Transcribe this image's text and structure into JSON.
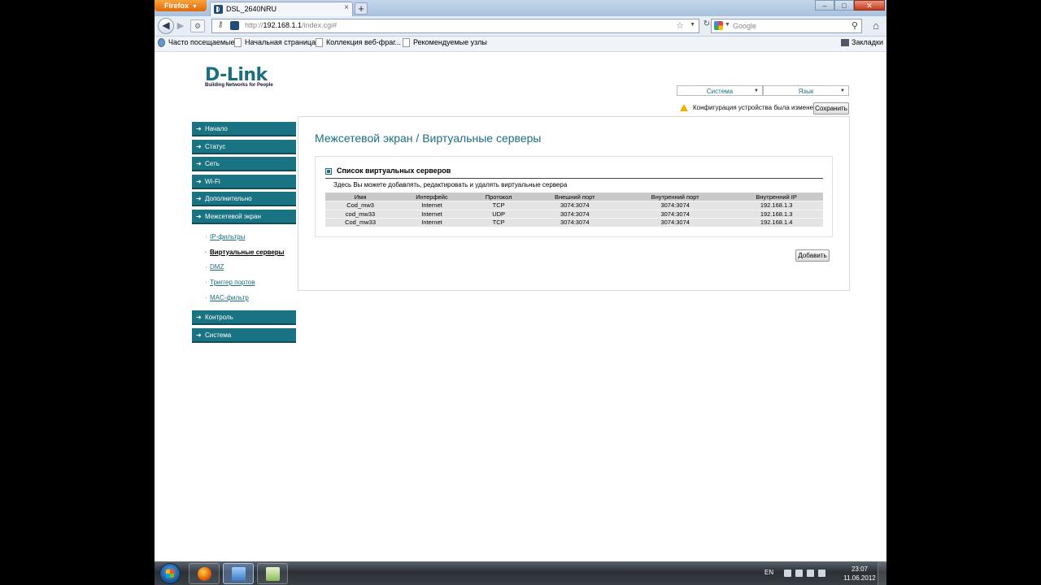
{
  "browser": {
    "app_button": "Firefox",
    "tab_title": "DSL_2640NRU",
    "new_tab_symbol": "+",
    "url_prefix": "http://",
    "url_host": "192.168.1.1",
    "url_path": "/index.cgi#",
    "search_placeholder": "Google",
    "bookmarks": [
      "Часто посещаемые",
      "Начальная страница",
      "Коллекция веб-фраг...",
      "Рекомендуемые узлы"
    ],
    "bookmarks_menu": "Закладки"
  },
  "header": {
    "logo": "D-Link",
    "tagline": "Building Networks for People",
    "system_select": "Система",
    "language_select": "Язык",
    "warning": "Конфигурация устройства была изменена",
    "save_button": "Сохранить"
  },
  "sidebar": {
    "items": [
      "Начало",
      "Статус",
      "Сеть",
      "Wi-Fi",
      "Дополнительно",
      "Межсетевой экран"
    ],
    "subitems": [
      "IP-фильтры",
      "Виртуальные серверы",
      "DMZ",
      "Триггер портов",
      "MAC-фильтр"
    ],
    "active_subitem": "Виртуальные серверы",
    "items_after": [
      "Контроль",
      "Система"
    ]
  },
  "main": {
    "title": "Межсетевой экран /  Виртуальные серверы",
    "panel_title": "Список виртуальных серверов",
    "panel_desc": "Здесь Вы можете добавлять, редактировать и удалять виртуальные сервера",
    "columns": [
      "Имя",
      "Интерфейс",
      "Протокол",
      "Внешний порт",
      "Внутренний порт",
      "Внутренний IP"
    ],
    "rows": [
      [
        "Cod_mw3",
        "Internet",
        "TCP",
        "3074:3074",
        "3074:3074",
        "192.168.1.3"
      ],
      [
        "cod_mw33",
        "Internet",
        "UDP",
        "3074:3074",
        "3074:3074",
        "192.168.1.3"
      ],
      [
        "Cod_mw33",
        "Internet",
        "TCP",
        "3074:3074",
        "3074:3074",
        "192.168.1.4"
      ]
    ],
    "add_button": "Добавить"
  },
  "taskbar": {
    "language": "EN",
    "time": "23:07",
    "date": "11.06.2012"
  },
  "colors": {
    "brand_teal": "#1a7383",
    "warning": "#f2b300"
  }
}
